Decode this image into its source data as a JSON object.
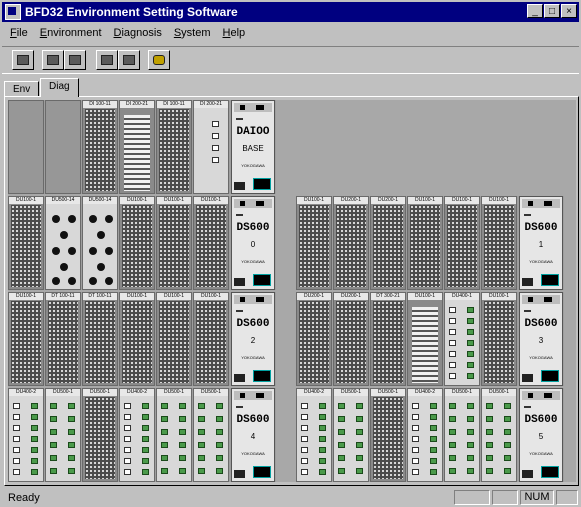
{
  "window": {
    "title": "BFD32 Environment Setting Software"
  },
  "menu": [
    {
      "key": "F",
      "rest": "ile"
    },
    {
      "key": "E",
      "rest": "nvironment"
    },
    {
      "key": "D",
      "rest": "iagnosis"
    },
    {
      "key": "S",
      "rest": "ystem"
    },
    {
      "key": "H",
      "rest": "elp"
    }
  ],
  "tabs": [
    {
      "label": "Env"
    },
    {
      "label": "Diag"
    }
  ],
  "controllers": [
    {
      "model": "DAIOO",
      "number": "BASE"
    },
    {
      "model": "DS600",
      "number": "0"
    },
    {
      "model": "DS600",
      "number": "1"
    },
    {
      "model": "DS600",
      "number": "2"
    },
    {
      "model": "DS600",
      "number": "3"
    },
    {
      "model": "DS600",
      "number": "4"
    },
    {
      "model": "DS600",
      "number": "5"
    }
  ],
  "controller_brand": "YOKOGAWA",
  "racks": [
    {
      "slots": [
        {
          "type": "empty",
          "label": ""
        },
        {
          "type": "empty",
          "label": ""
        },
        {
          "type": "std",
          "label": "DI 100-11"
        },
        {
          "type": "ai",
          "label": "DI 200-21"
        },
        {
          "type": "std",
          "label": "DI 100-11"
        },
        {
          "type": "xl",
          "label": "DI 200-21"
        }
      ]
    },
    {
      "slots": [
        {
          "type": "std",
          "label": "DU100-1"
        },
        {
          "type": "dots",
          "label": "DU500-14"
        },
        {
          "type": "dots",
          "label": "DU500-14"
        },
        {
          "type": "std",
          "label": "DU100-1"
        },
        {
          "type": "std",
          "label": "DU100-1"
        },
        {
          "type": "std",
          "label": "DU100-1"
        }
      ]
    },
    {
      "slots": [
        {
          "type": "std",
          "label": "DU100-1"
        },
        {
          "type": "std",
          "label": "DU200-1"
        },
        {
          "type": "std",
          "label": "DU200-1"
        },
        {
          "type": "std",
          "label": "DU100-1"
        },
        {
          "type": "std",
          "label": "DU100-1"
        },
        {
          "type": "std",
          "label": "DU100-1"
        }
      ]
    },
    {
      "slots": [
        {
          "type": "std",
          "label": "DU100-1"
        },
        {
          "type": "std",
          "label": "DT 100-11"
        },
        {
          "type": "std",
          "label": "DT 100-11"
        },
        {
          "type": "std",
          "label": "DU100-1"
        },
        {
          "type": "std",
          "label": "DU100-1"
        },
        {
          "type": "std",
          "label": "DU100-1"
        }
      ]
    },
    {
      "slots": [
        {
          "type": "std",
          "label": "DU200-1"
        },
        {
          "type": "std",
          "label": "DU200-1"
        },
        {
          "type": "std",
          "label": "DT 300-21"
        },
        {
          "type": "ai",
          "label": "DU100-1"
        },
        {
          "type": "green",
          "label": "DU400-1"
        },
        {
          "type": "std",
          "label": "DU100-1"
        }
      ]
    },
    {
      "slots": [
        {
          "type": "green",
          "label": "DU400-2"
        },
        {
          "type": "gr2",
          "label": "DU500-1"
        },
        {
          "type": "std",
          "label": "DU500-1"
        },
        {
          "type": "green",
          "label": "DU400-2"
        },
        {
          "type": "gr2",
          "label": "DU500-1"
        },
        {
          "type": "gr2",
          "label": "DU500-1"
        }
      ]
    }
  ],
  "status": {
    "text": "Ready",
    "num": "NUM"
  }
}
